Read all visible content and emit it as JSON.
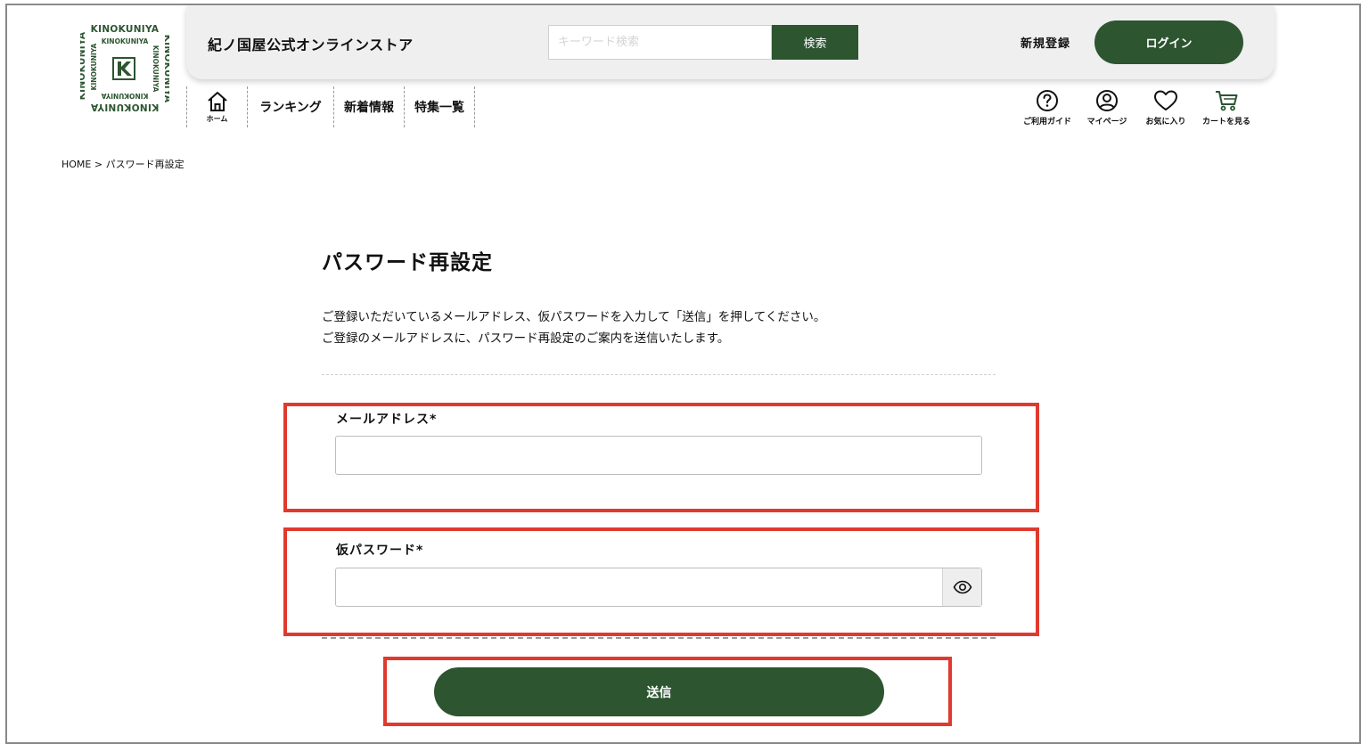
{
  "brand": {
    "logo_text": "KINOKUNIYA",
    "store_name": "紀ノ国屋公式オンラインストア",
    "accent_color": "#2c5530"
  },
  "header": {
    "search_placeholder": "キーワード検索",
    "search_button": "検索",
    "register_label": "新規登録",
    "login_button": "ログイン"
  },
  "nav": {
    "home_label": "ホーム",
    "items": [
      "ランキング",
      "新着情報",
      "特集一覧"
    ]
  },
  "utility": {
    "guide": "ご利用ガイド",
    "mypage": "マイページ",
    "favorites": "お気に入り",
    "cart": "カートを見る"
  },
  "breadcrumb": "HOME > パスワード再設定",
  "page": {
    "title": "パスワード再設定",
    "desc_line1": "ご登録いただいているメールアドレス、仮パスワードを入力して「送信」を押してください。",
    "desc_line2": "ご登録のメールアドレスに、パスワード再設定のご案内を送信いたします。"
  },
  "form": {
    "email_label": "メールアドレス*",
    "email_value": "",
    "temp_password_label": "仮パスワード*",
    "temp_password_value": "",
    "submit_label": "送信"
  },
  "highlight_color": "#e03a2e"
}
